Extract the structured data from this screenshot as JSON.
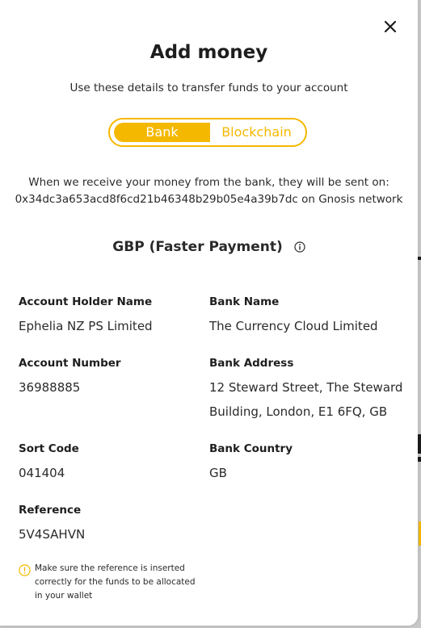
{
  "modal": {
    "title": "Add money",
    "subtitle": "Use these details to transfer funds to your account",
    "tabs": [
      {
        "label": "Bank",
        "selected": true
      },
      {
        "label": "Blockchain",
        "selected": false
      }
    ],
    "notice_line1": "When we receive your money from the bank, they will be sent on:",
    "notice_line2": "0x34dc3a653acd8f6cd21b46348b29b05e4a39b7dc on Gnosis network",
    "currency_heading": "GBP (Faster Payment)",
    "fields": {
      "account_holder": {
        "label": "Account Holder Name",
        "value": "Ephelia NZ PS Limited"
      },
      "bank_name": {
        "label": "Bank Name",
        "value": "The Currency Cloud Limited"
      },
      "account_number": {
        "label": "Account Number",
        "value": "36988885"
      },
      "bank_address": {
        "label": "Bank Address",
        "value_line1": "12 Steward Street, The Steward",
        "value_line2": "Building, London, E1 6FQ, GB"
      },
      "sort_code": {
        "label": "Sort Code",
        "value": "041404"
      },
      "bank_country": {
        "label": "Bank Country",
        "value": "GB"
      },
      "reference": {
        "label": "Reference",
        "value": "5V4SAHVN"
      }
    },
    "warning": {
      "line1": "Make sure the reference is inserted",
      "line2": "correctly for the funds to be allocated",
      "line3": "in your wallet"
    }
  },
  "icons": {
    "close": "close-icon",
    "info": "info-icon",
    "warning": "warning-icon"
  },
  "colors": {
    "accent": "#f5b800",
    "text": "#2a2a2a",
    "background": "#ffffff"
  }
}
